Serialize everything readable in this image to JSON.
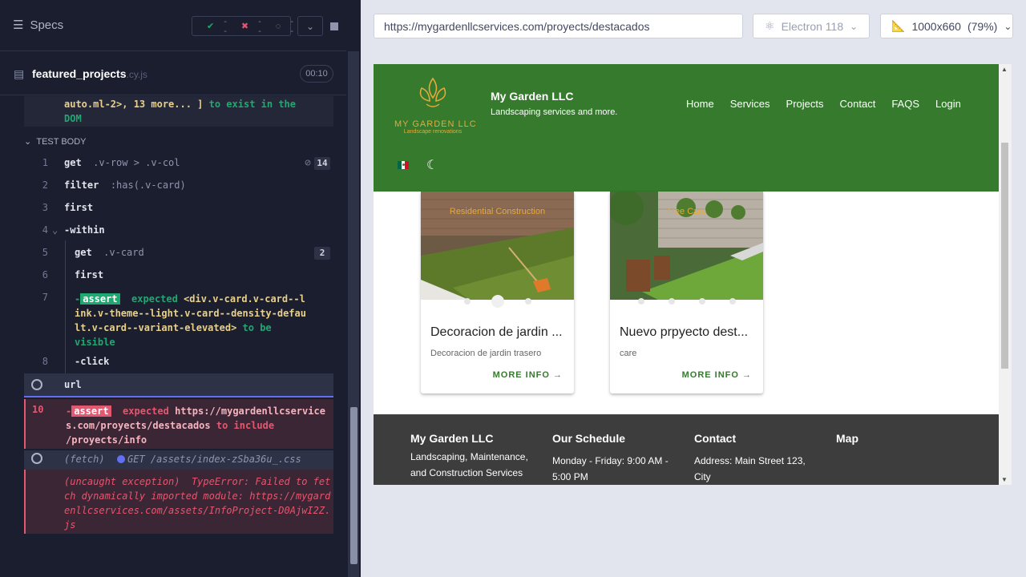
{
  "runner": {
    "specs_label": "Specs",
    "stats": {
      "passed": "--",
      "failed": "--",
      "pending": "--"
    },
    "file": {
      "name": "featured_projects",
      "ext": ".cy.js",
      "timer": "00:10"
    },
    "prev_message": {
      "line1": "auto.ml-2>, 13 more... ]",
      "line1b": "to exist in the",
      "line2": "DOM"
    },
    "section_label": "TEST BODY",
    "commands": [
      {
        "num": "1",
        "name": "get",
        "arg": ".v-row > .v-col",
        "badge": "14"
      },
      {
        "num": "2",
        "name": "filter",
        "arg": ":has(.v-card)"
      },
      {
        "num": "3",
        "name": "first",
        "arg": ""
      },
      {
        "num": "4",
        "name": "-within",
        "arg": ""
      },
      {
        "num": "5",
        "name": "get",
        "arg": ".v-card",
        "badge": "2"
      },
      {
        "num": "6",
        "name": "first",
        "arg": ""
      },
      {
        "num": "7",
        "tag": "assert",
        "text_expected": "expected",
        "text_el": "<div.v-card.v-card--link.v-theme--light.v-card--density-default.v-card--variant-elevated>",
        "text_tail": "to be visible"
      },
      {
        "num": "8",
        "name": "-click",
        "arg": ""
      },
      {
        "num": "",
        "name": "url",
        "arg": ""
      },
      {
        "num": "10",
        "tag": "assert",
        "text_expected": "expected",
        "text_url": "https://mygardenllcservices.com/proyects/destacados",
        "text_include": "to include",
        "text_path": "/proyects/info"
      },
      {
        "name": "(fetch)",
        "arg": "GET /assets/index-zSba36u_.css"
      },
      {
        "name": "(uncaught exception)",
        "arg": "TypeError: Failed to fetch dynamically imported module: https://mygardenllcservices.com/assets/InfoProject-D0AjwI2Z.js"
      }
    ]
  },
  "browser": {
    "url": "https://mygardenllcservices.com/proyects/destacados",
    "engine": "Electron 118",
    "viewport": "1000x660",
    "zoom": "(79%)"
  },
  "site": {
    "logo_text": "MY GARDEN LLC",
    "logo_sub": "Landscape renovations",
    "brand": "My Garden LLC",
    "tagline": "Landscaping services and more.",
    "nav": [
      "Home",
      "Services",
      "Projects",
      "Contact",
      "FAQS",
      "Login"
    ],
    "cards": [
      {
        "category": "Residential Construction",
        "title": "Decoracion de jardin ...",
        "subtitle": "Decoracion de jardin trasero",
        "button": "MORE INFO"
      },
      {
        "category": "Tree Care",
        "title": "Nuevo prpyecto dest...",
        "subtitle": "care",
        "button": "MORE INFO"
      }
    ],
    "footer": [
      {
        "heading": "My Garden LLC",
        "body": "Landscaping, Maintenance, and Construction Services"
      },
      {
        "heading": "Our Schedule",
        "body": "Monday - Friday: 9:00 AM - 5:00 PM"
      },
      {
        "heading": "Contact",
        "body": "Address: Main Street 123, City"
      },
      {
        "heading": "Map",
        "body": ""
      }
    ]
  }
}
